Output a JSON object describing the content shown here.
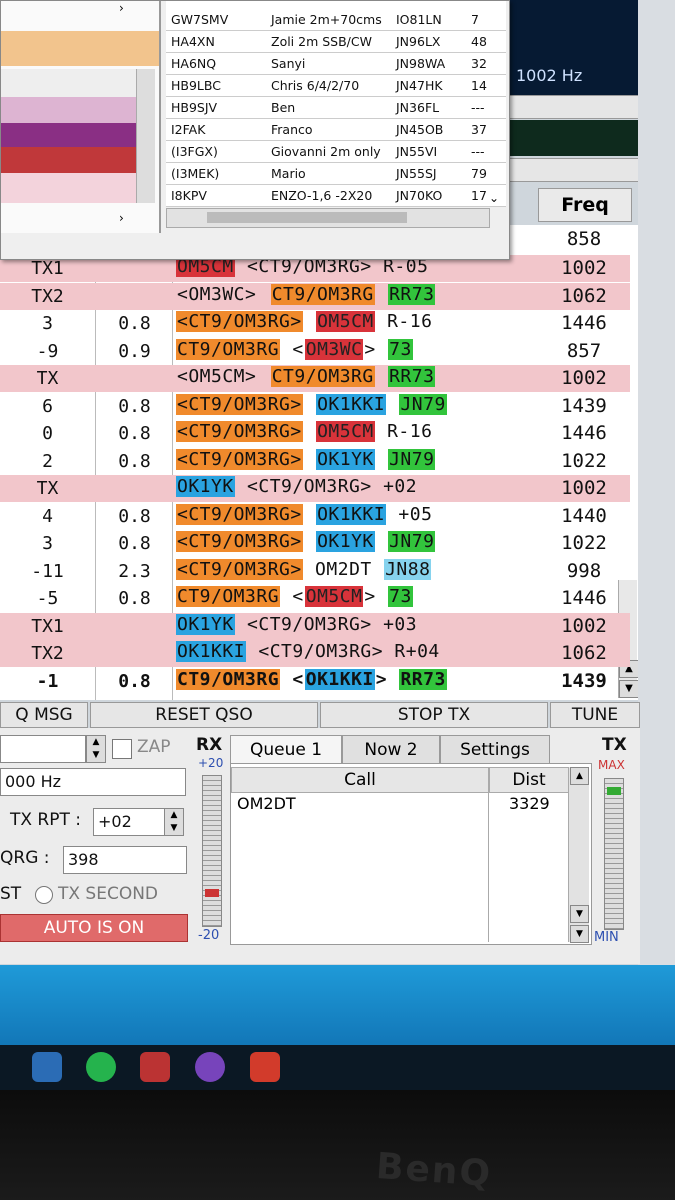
{
  "popup_table": [
    {
      "call": "GW7SMV",
      "name": "Jamie 2m+70cms",
      "loc": "IO81LN",
      "n": "7"
    },
    {
      "call": "HA4XN",
      "name": "Zoli 2m SSB/CW",
      "loc": "JN96LX",
      "n": "48"
    },
    {
      "call": "HA6NQ",
      "name": "Sanyi",
      "loc": "JN98WA",
      "n": "32"
    },
    {
      "call": "HB9LBC",
      "name": "Chris 6/4/2/70",
      "loc": "JN47HK",
      "n": "14"
    },
    {
      "call": "HB9SJV",
      "name": "Ben",
      "loc": "JN36FL",
      "n": "---"
    },
    {
      "call": "I2FAK",
      "name": "Franco",
      "loc": "JN45OB",
      "n": "37"
    },
    {
      "call": "(I3FGX)",
      "name": "Giovanni 2m only",
      "loc": "JN55VI",
      "n": "---"
    },
    {
      "call": "(I3MEK)",
      "name": "Mario",
      "loc": "JN55SJ",
      "n": "79"
    },
    {
      "call": "I8KPV",
      "name": "ENZO-1,6 -2X20",
      "loc": "JN70KO",
      "n": "17"
    }
  ],
  "waterfall_hz": "1002 Hz",
  "freq_header": "Freq",
  "first_freq": "858",
  "rows": [
    {
      "db": "TX1",
      "dt": "",
      "tx": true,
      "parts": [
        {
          "t": "OM5CM",
          "c": "red"
        },
        {
          "t": " <CT9/OM3RG> R-05",
          "c": ""
        }
      ],
      "freq": "1002"
    },
    {
      "db": "TX2",
      "dt": "",
      "tx": true,
      "parts": [
        {
          "t": "<OM3WC>",
          "c": ""
        },
        {
          "t": " ",
          "c": ""
        },
        {
          "t": "CT9/OM3RG",
          "c": "org"
        },
        {
          "t": " ",
          "c": ""
        },
        {
          "t": "RR73",
          "c": "green"
        }
      ],
      "freq": "1062"
    },
    {
      "db": "3",
      "dt": "0.8",
      "tx": false,
      "parts": [
        {
          "t": "<CT9/OM3RG>",
          "c": "org"
        },
        {
          "t": " ",
          "c": ""
        },
        {
          "t": "OM5CM",
          "c": "red"
        },
        {
          "t": " R-16",
          "c": ""
        }
      ],
      "freq": "1446"
    },
    {
      "db": "-9",
      "dt": "0.9",
      "tx": false,
      "parts": [
        {
          "t": "CT9/OM3RG",
          "c": "org"
        },
        {
          "t": " <",
          "c": ""
        },
        {
          "t": "OM3WC",
          "c": "red"
        },
        {
          "t": "> ",
          "c": ""
        },
        {
          "t": "73",
          "c": "green"
        }
      ],
      "freq": "857"
    },
    {
      "db": "TX",
      "dt": "",
      "tx": true,
      "parts": [
        {
          "t": "<OM5CM>",
          "c": ""
        },
        {
          "t": " ",
          "c": ""
        },
        {
          "t": "CT9/OM3RG",
          "c": "org"
        },
        {
          "t": " ",
          "c": ""
        },
        {
          "t": "RR73",
          "c": "green"
        }
      ],
      "freq": "1002"
    },
    {
      "db": "6",
      "dt": "0.8",
      "tx": false,
      "parts": [
        {
          "t": "<CT9/OM3RG>",
          "c": "org"
        },
        {
          "t": " ",
          "c": ""
        },
        {
          "t": "OK1KKI",
          "c": "blue"
        },
        {
          "t": " ",
          "c": ""
        },
        {
          "t": "JN79",
          "c": "green"
        }
      ],
      "freq": "1439"
    },
    {
      "db": "0",
      "dt": "0.8",
      "tx": false,
      "parts": [
        {
          "t": "<CT9/OM3RG>",
          "c": "org"
        },
        {
          "t": " ",
          "c": ""
        },
        {
          "t": "OM5CM",
          "c": "red"
        },
        {
          "t": " R-16",
          "c": ""
        }
      ],
      "freq": "1446"
    },
    {
      "db": "2",
      "dt": "0.8",
      "tx": false,
      "parts": [
        {
          "t": "<CT9/OM3RG>",
          "c": "org"
        },
        {
          "t": " ",
          "c": ""
        },
        {
          "t": "OK1YK",
          "c": "blue"
        },
        {
          "t": " ",
          "c": ""
        },
        {
          "t": "JN79",
          "c": "green"
        }
      ],
      "freq": "1022"
    },
    {
      "db": "TX",
      "dt": "",
      "tx": true,
      "parts": [
        {
          "t": "OK1YK",
          "c": "blue"
        },
        {
          "t": " <CT9/OM3RG> +02",
          "c": ""
        }
      ],
      "freq": "1002"
    },
    {
      "db": "4",
      "dt": "0.8",
      "tx": false,
      "parts": [
        {
          "t": "<CT9/OM3RG>",
          "c": "org"
        },
        {
          "t": " ",
          "c": ""
        },
        {
          "t": "OK1KKI",
          "c": "blue"
        },
        {
          "t": " +05",
          "c": ""
        }
      ],
      "freq": "1440"
    },
    {
      "db": "3",
      "dt": "0.8",
      "tx": false,
      "parts": [
        {
          "t": "<CT9/OM3RG>",
          "c": "org"
        },
        {
          "t": " ",
          "c": ""
        },
        {
          "t": "OK1YK",
          "c": "blue"
        },
        {
          "t": " ",
          "c": ""
        },
        {
          "t": "JN79",
          "c": "green"
        }
      ],
      "freq": "1022"
    },
    {
      "db": "-11",
      "dt": "2.3",
      "tx": false,
      "parts": [
        {
          "t": "<CT9/OM3RG>",
          "c": "org"
        },
        {
          "t": " OM2DT ",
          "c": ""
        },
        {
          "t": "JN88",
          "c": "ltblue"
        }
      ],
      "freq": "998"
    },
    {
      "db": "-5",
      "dt": "0.8",
      "tx": false,
      "parts": [
        {
          "t": "CT9/OM3RG",
          "c": "org"
        },
        {
          "t": " <",
          "c": ""
        },
        {
          "t": "OM5CM",
          "c": "red"
        },
        {
          "t": "> ",
          "c": ""
        },
        {
          "t": "73",
          "c": "green"
        }
      ],
      "freq": "1446"
    },
    {
      "db": "TX1",
      "dt": "",
      "tx": true,
      "parts": [
        {
          "t": "OK1YK",
          "c": "blue"
        },
        {
          "t": " <CT9/OM3RG> +03",
          "c": ""
        }
      ],
      "freq": "1002"
    },
    {
      "db": "TX2",
      "dt": "",
      "tx": true,
      "parts": [
        {
          "t": "OK1KKI",
          "c": "blue"
        },
        {
          "t": " <CT9/OM3RG> R+04",
          "c": ""
        }
      ],
      "freq": "1062"
    },
    {
      "db": "-1",
      "dt": "0.8",
      "tx": false,
      "bold": true,
      "parts": [
        {
          "t": "CT9/OM3RG",
          "c": "org"
        },
        {
          "t": " <",
          "c": ""
        },
        {
          "t": "OK1KKI",
          "c": "blue"
        },
        {
          "t": "> ",
          "c": ""
        },
        {
          "t": "RR73",
          "c": "green"
        }
      ],
      "freq": "1439"
    }
  ],
  "buttons": {
    "q_msg": "Q MSG",
    "reset_qso": "RESET QSO",
    "stop_tx": "STOP TX",
    "tune": "TUNE"
  },
  "controls": {
    "zap": "ZAP",
    "hz_value": "000  Hz",
    "tx_rpt_label": "TX RPT :",
    "tx_rpt_value": "+02",
    "qrg_label": "QRG :",
    "qrg_value": "398",
    "first_label": "ST",
    "tx_second": "TX SECOND",
    "auto_is_on": "AUTO IS ON"
  },
  "meters": {
    "rx": "RX",
    "rx_top": "+20",
    "rx_bottom": "-20",
    "tx": "TX",
    "tx_max": "MAX",
    "tx_min": "MIN"
  },
  "tabs": {
    "queue1": "Queue 1",
    "now2": "Now 2",
    "settings": "Settings"
  },
  "queue": {
    "col_call": "Call",
    "col_dist": "Dist",
    "entries": [
      {
        "call": "OM2DT",
        "dist": "3329"
      }
    ]
  },
  "colors": {
    "org": "#f08a2c",
    "red": "#d8333a",
    "blue": "#2aa3e0",
    "green": "#32c43c",
    "ltblue": "#86d3ee",
    "tx_row": "#f2c6cb",
    "auto_on": "#e06a6a"
  }
}
